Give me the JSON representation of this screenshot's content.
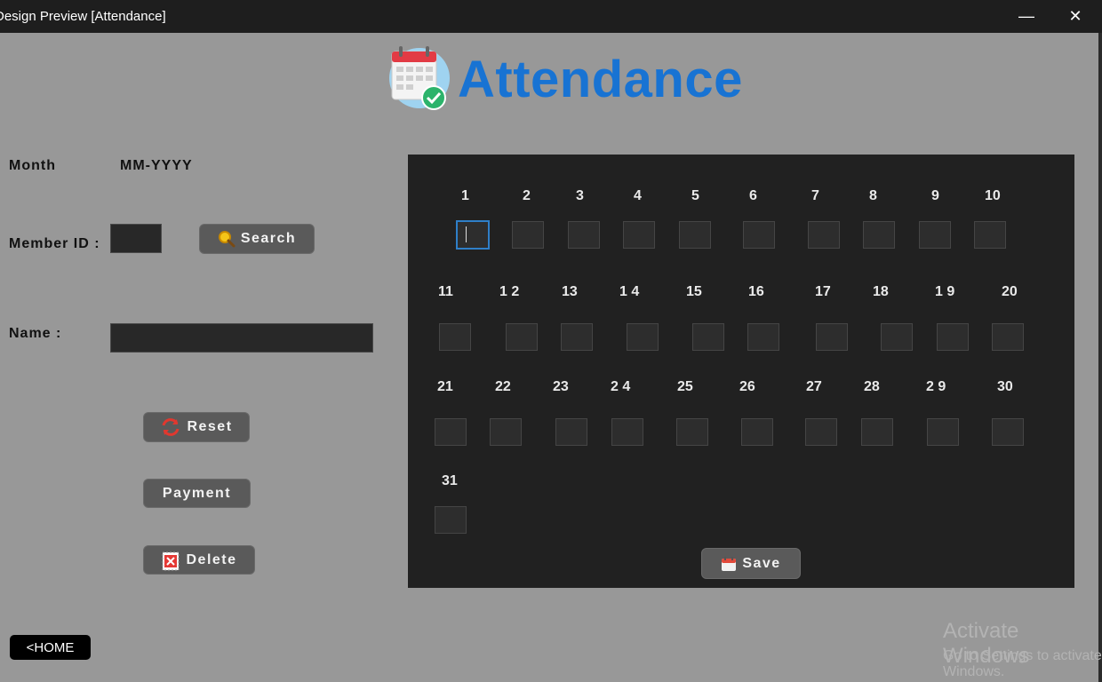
{
  "window": {
    "title": "Design Preview [Attendance]",
    "minimize": "—",
    "close": "✕"
  },
  "header": {
    "title": "Attendance",
    "icon": "calendar-check-icon"
  },
  "form": {
    "month_label": "Month",
    "month_placeholder": "MM-YYYY",
    "member_id_label": "Member ID :",
    "name_label": "Name :",
    "search_label": "Search",
    "reset_label": "Reset",
    "payment_label": "Payment",
    "delete_label": "Delete",
    "home_label": "<HOME"
  },
  "days": {
    "d1": "1",
    "d2": "2",
    "d3": "3",
    "d4": "4",
    "d5": "5",
    "d6": "6",
    "d7": "7",
    "d8": "8",
    "d9": "9",
    "d10": "10",
    "d11": "11",
    "d12": "1 2",
    "d13": "13",
    "d14": "1 4",
    "d15": "15",
    "d16": "16",
    "d17": "17",
    "d18": "18",
    "d19": "1 9",
    "d20": "20",
    "d21": "21",
    "d22": "22",
    "d23": "23",
    "d24": "2 4",
    "d25": "25",
    "d26": "26",
    "d27": "27",
    "d28": "28",
    "d29": "2 9",
    "d30": "30",
    "d31": "31"
  },
  "save_label": "Save",
  "watermark": {
    "line1": "Activate Windows",
    "line2": "Go to Settings to activate Windows."
  },
  "colors": {
    "accent": "#1873d3",
    "panel": "#212121",
    "background": "#989898"
  }
}
